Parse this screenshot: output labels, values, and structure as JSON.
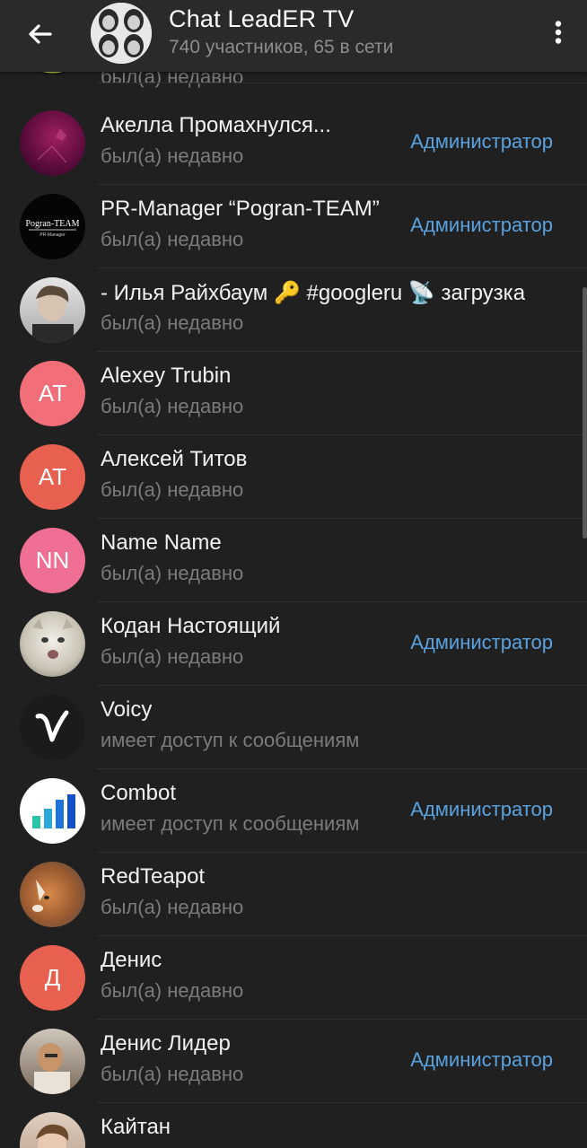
{
  "header": {
    "title": "Chat LeadER TV",
    "subtitle": "740 участников, 65 в сети"
  },
  "colors": {
    "accent": "#5aa2df",
    "header_bg": "#2a2a2a",
    "list_bg": "#202020"
  },
  "members": [
    {
      "name": "",
      "status": "был(а) недавно",
      "role": "",
      "avatar_type": "photo",
      "avatar_color": "#0e0e0e"
    },
    {
      "name": "Акелла Промахнулся...",
      "status": "был(а) недавно",
      "role": "Администратор",
      "avatar_type": "photo",
      "avatar_color": "#6a1040"
    },
    {
      "name": "PR-Manager “Pogran-TEAM”",
      "status": "был(а) недавно",
      "role": "Администратор",
      "avatar_type": "logo",
      "avatar_color": "#0a0a0a"
    },
    {
      "name": "- Илья Райхбаум 🔑 #googleru 📡 загрузка",
      "status": "был(а) недавно",
      "role": "",
      "avatar_type": "photo",
      "avatar_color": "#c8c8c8"
    },
    {
      "name": "Alexey Trubin",
      "status": "был(а) недавно",
      "role": "",
      "avatar_type": "initials",
      "initials": "AT",
      "avatar_color": "#f26f7a"
    },
    {
      "name": "Алексей Титов",
      "status": "был(а) недавно",
      "role": "",
      "avatar_type": "initials",
      "initials": "АТ",
      "avatar_color": "#e8604f"
    },
    {
      "name": "Name Name",
      "status": "был(а) недавно",
      "role": "",
      "avatar_type": "initials",
      "initials": "NN",
      "avatar_color": "#ef6e94"
    },
    {
      "name": "Кодан Настоящий",
      "status": "был(а) недавно",
      "role": "Администратор",
      "avatar_type": "photo",
      "avatar_color": "#b8b4a6"
    },
    {
      "name": "Voicy",
      "status": "имеет доступ к сообщениям",
      "role": "",
      "avatar_type": "logo",
      "avatar_color": "#1b1b1b"
    },
    {
      "name": "Combot",
      "status": "имеет доступ к сообщениям",
      "role": "Администратор",
      "avatar_type": "logo",
      "avatar_color": "#ffffff"
    },
    {
      "name": "RedTeapot",
      "status": "был(а) недавно",
      "role": "",
      "avatar_type": "photo",
      "avatar_color": "#9a6a4a"
    },
    {
      "name": "Денис",
      "status": "был(а) недавно",
      "role": "",
      "avatar_type": "initials",
      "initials": "Д",
      "avatar_color": "#e8604f"
    },
    {
      "name": "Денис Лидер",
      "status": "был(а) недавно",
      "role": "Администратор",
      "avatar_type": "photo",
      "avatar_color": "#8a7a6a"
    },
    {
      "name": "Кайтан",
      "status": "",
      "role": "",
      "avatar_type": "photo",
      "avatar_color": "#d8c8b8"
    }
  ]
}
